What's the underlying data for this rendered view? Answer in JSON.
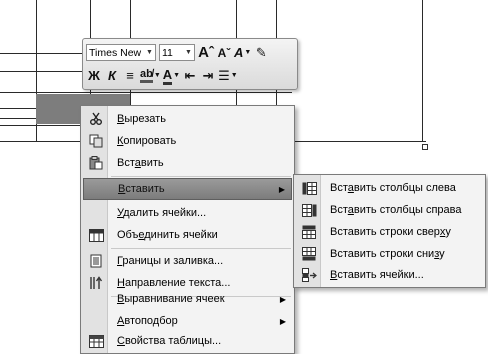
{
  "mini_toolbar": {
    "font_name": "Times New",
    "font_size": "11",
    "row1_buttons": [
      {
        "name": "grow-font-button",
        "label": "Aˆ"
      },
      {
        "name": "shrink-font-button",
        "label": "Aˇ"
      },
      {
        "name": "styles-button",
        "label": "A"
      },
      {
        "name": "format-painter-button",
        "label": "✎"
      }
    ],
    "row2_buttons": [
      {
        "name": "bold-button",
        "label": "Ж"
      },
      {
        "name": "italic-button",
        "label": "К"
      },
      {
        "name": "center-button",
        "label": "≡"
      },
      {
        "name": "highlight-button",
        "label": "ab̸"
      },
      {
        "name": "font-color-button",
        "label": "A"
      },
      {
        "name": "decrease-indent-button",
        "label": "⇤"
      },
      {
        "name": "increase-indent-button",
        "label": "⇥"
      },
      {
        "name": "bullets-button",
        "label": "☰"
      }
    ]
  },
  "context_menu": {
    "items": [
      {
        "pre": "",
        "ul": "В",
        "post": "ырезать",
        "icon": "scissors-icon",
        "submenu": false
      },
      {
        "pre": "",
        "ul": "К",
        "post": "опировать",
        "icon": "copy-icon",
        "submenu": false
      },
      {
        "pre": "Вст",
        "ul": "а",
        "post": "вить",
        "icon": "paste-icon",
        "submenu": false
      },
      {
        "pre": "",
        "ul": "В",
        "post": "ставить",
        "icon": "",
        "submenu": true,
        "active": true
      },
      {
        "pre": "",
        "ul": "У",
        "post": "далить ячейки...",
        "icon": "",
        "submenu": false
      },
      {
        "pre": "Объ",
        "ul": "е",
        "post": "динить ячейки",
        "icon": "merge-cells-icon",
        "submenu": false
      },
      {
        "pre": "",
        "ul": "Г",
        "post": "раницы и заливка...",
        "icon": "borders-icon",
        "submenu": false
      },
      {
        "pre": "",
        "ul": "Н",
        "post": "аправление текста...",
        "icon": "text-direction-icon",
        "submenu": false
      },
      {
        "pre": "",
        "ul": "В",
        "post": "ыравнивание ячеек",
        "icon": "",
        "submenu": true
      },
      {
        "pre": "",
        "ul": "А",
        "post": "втоподбор",
        "icon": "",
        "submenu": true
      },
      {
        "pre": "",
        "ul": "С",
        "post": "войства таблицы...",
        "icon": "table-properties-icon",
        "submenu": false
      }
    ]
  },
  "insert_submenu": {
    "items": [
      {
        "pre": "Вст",
        "ul": "а",
        "post": "вить столбцы слева",
        "icon": "insert-columns-left-icon"
      },
      {
        "pre": "Вст",
        "ul": "а",
        "post": "вить столбцы справа",
        "icon": "insert-columns-right-icon"
      },
      {
        "pre": "Вставить строки свер",
        "ul": "х",
        "post": "у",
        "icon": "insert-rows-above-icon"
      },
      {
        "pre": "Вставить строки сни",
        "ul": "з",
        "post": "у",
        "icon": "insert-rows-below-icon"
      },
      {
        "pre": "",
        "ul": "В",
        "post": "ставить ячейки...",
        "icon": "insert-cells-icon"
      }
    ]
  }
}
